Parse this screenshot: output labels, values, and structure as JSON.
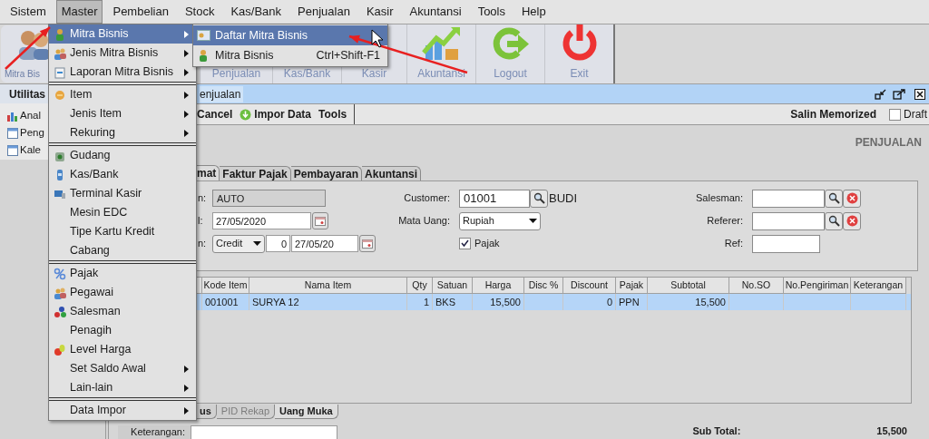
{
  "menubar": [
    {
      "label": "Sistem",
      "selected": false
    },
    {
      "label": "Master",
      "selected": true
    },
    {
      "label": "Pembelian",
      "selected": false
    },
    {
      "label": "Stock",
      "selected": false
    },
    {
      "label": "Kas/Bank",
      "selected": false
    },
    {
      "label": "Penjualan",
      "selected": false
    },
    {
      "label": "Kasir",
      "selected": false
    },
    {
      "label": "Akuntansi",
      "selected": false
    },
    {
      "label": "Tools",
      "selected": false
    },
    {
      "label": "Help",
      "selected": false
    }
  ],
  "toolbar": {
    "left": [
      {
        "label": "Mitra Bis"
      }
    ],
    "right": [
      {
        "label": "Penjualan"
      },
      {
        "label": "Kas/Bank"
      },
      {
        "label": "Kasir"
      },
      {
        "label": "Akuntansi"
      },
      {
        "label": "Logout"
      },
      {
        "label": "Exit"
      }
    ]
  },
  "sidebar": {
    "title": "Utilitas",
    "items": [
      {
        "label": "Anal"
      },
      {
        "label": "Peng"
      },
      {
        "label": "Kale"
      }
    ]
  },
  "frame": {
    "title": "enjualan",
    "actions": [
      {
        "label": "Cancel",
        "icon": false
      },
      {
        "label": "Impor Data",
        "icon": true
      },
      {
        "label": "Tools",
        "icon": false
      }
    ],
    "salin": "Salin Memorized",
    "draft": {
      "label": "Draft",
      "checked": false
    },
    "heading": "PENJUALAN"
  },
  "tabs": [
    {
      "label": "mat",
      "selected": true
    },
    {
      "label": "Faktur Pajak",
      "selected": false
    },
    {
      "label": "Pembayaran",
      "selected": false
    },
    {
      "label": "Akuntansi",
      "selected": false
    }
  ],
  "form": {
    "left": [
      {
        "label": "n:",
        "value": "AUTO"
      },
      {
        "label": "l:",
        "value": "27/05/2020"
      },
      {
        "label": "n:",
        "term": "Credit",
        "days": "0",
        "value": "27/05/20"
      }
    ],
    "customer": {
      "label": "Customer:",
      "value": "01001",
      "name": "BUDI"
    },
    "currency": {
      "label": "Mata Uang:",
      "value": "Rupiah"
    },
    "tax": {
      "label": "Pajak",
      "checked": true
    },
    "salesman": {
      "label": "Salesman:"
    },
    "referer": {
      "label": "Referer:"
    },
    "ref": {
      "label": "Ref:"
    }
  },
  "table": {
    "columns": [
      "",
      "Kode Item",
      "Nama Item",
      "Qty",
      "Satuan",
      "Harga",
      "Disc %",
      "Discount",
      "Pajak",
      "Subtotal",
      "No.SO",
      "No.Pengiriman",
      "Keterangan"
    ],
    "rows": [
      {
        "selected": true,
        "cells": [
          "",
          "001001",
          "SURYA 12",
          "1",
          "BKS",
          "15,500",
          "",
          "0",
          "PPN",
          "15,500",
          "",
          "",
          ""
        ]
      }
    ]
  },
  "bottom_tabs": [
    {
      "label": "us",
      "selected": false,
      "disabled": false
    },
    {
      "label": "PID Rekap",
      "selected": false,
      "disabled": true
    },
    {
      "label": "Uang Muka",
      "selected": true,
      "disabled": false
    }
  ],
  "footer": {
    "note_label": "Keterangan:",
    "subtotal_label": "Sub Total:",
    "subtotal": "15,500"
  },
  "menu": [
    {
      "label": "Mitra Bisnis",
      "icon": true,
      "submenu": true,
      "selected": true,
      "separator_after": false
    },
    {
      "label": "Jenis Mitra Bisnis",
      "icon": true,
      "submenu": true,
      "selected": false,
      "separator_after": false
    },
    {
      "label": "Laporan Mitra Bisnis",
      "icon": true,
      "submenu": true,
      "selected": false,
      "separator_after": true
    },
    {
      "label": "Item",
      "icon": true,
      "submenu": true,
      "selected": false,
      "separator_after": false
    },
    {
      "label": "Jenis Item",
      "icon": false,
      "submenu": true,
      "selected": false,
      "separator_after": false
    },
    {
      "label": "Rekuring",
      "icon": false,
      "submenu": true,
      "selected": false,
      "separator_after": true
    },
    {
      "label": "Gudang",
      "icon": true,
      "submenu": false,
      "selected": false,
      "separator_after": false
    },
    {
      "label": "Kas/Bank",
      "icon": true,
      "submenu": false,
      "selected": false,
      "separator_after": false
    },
    {
      "label": "Terminal Kasir",
      "icon": true,
      "submenu": false,
      "selected": false,
      "separator_after": false
    },
    {
      "label": "Mesin EDC",
      "icon": false,
      "submenu": false,
      "selected": false,
      "separator_after": false
    },
    {
      "label": "Tipe Kartu Kredit",
      "icon": false,
      "submenu": false,
      "selected": false,
      "separator_after": false
    },
    {
      "label": "Cabang",
      "icon": false,
      "submenu": false,
      "selected": false,
      "separator_after": true
    },
    {
      "label": "Pajak",
      "icon": true,
      "submenu": false,
      "selected": false,
      "separator_after": false
    },
    {
      "label": "Pegawai",
      "icon": true,
      "submenu": false,
      "selected": false,
      "separator_after": false
    },
    {
      "label": "Salesman",
      "icon": true,
      "submenu": false,
      "selected": false,
      "separator_after": false
    },
    {
      "label": "Penagih",
      "icon": false,
      "submenu": false,
      "selected": false,
      "separator_after": false
    },
    {
      "label": "Level Harga",
      "icon": true,
      "submenu": false,
      "selected": false,
      "separator_after": false
    },
    {
      "label": "Set Saldo Awal",
      "icon": false,
      "submenu": true,
      "selected": false,
      "separator_after": false
    },
    {
      "label": "Lain-lain",
      "icon": false,
      "submenu": true,
      "selected": false,
      "separator_after": true
    },
    {
      "label": "Data Impor",
      "icon": false,
      "submenu": true,
      "selected": false,
      "separator_after": false
    }
  ],
  "submenu": [
    {
      "label": "Daftar Mitra Bisnis",
      "selected": true
    },
    {
      "label": "Mitra Bisnis",
      "shortcut": "Ctrl+Shift-F1",
      "selected": false
    }
  ]
}
